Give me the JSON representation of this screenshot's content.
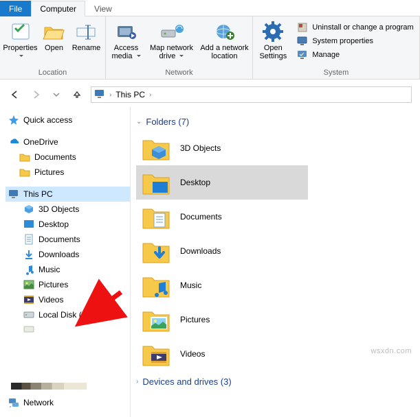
{
  "tabs": {
    "file": "File",
    "computer": "Computer",
    "view": "View"
  },
  "ribbon": {
    "location": {
      "label": "Location",
      "properties": "Properties",
      "open": "Open",
      "rename": "Rename"
    },
    "network": {
      "label": "Network",
      "access_media": "Access media",
      "map_drive": "Map network drive",
      "add_location": "Add a network location"
    },
    "system": {
      "label": "System",
      "open_settings": "Open Settings",
      "uninstall": "Uninstall or change a program",
      "properties": "System properties",
      "manage": "Manage"
    }
  },
  "address": {
    "location": "This PC"
  },
  "tree": {
    "quick_access": "Quick access",
    "onedrive": "OneDrive",
    "onedrive_items": [
      "Documents",
      "Pictures"
    ],
    "this_pc": "This PC",
    "this_pc_items": [
      "3D Objects",
      "Desktop",
      "Documents",
      "Downloads",
      "Music",
      "Pictures",
      "Videos",
      "Local Disk (C:)"
    ],
    "network": "Network"
  },
  "content": {
    "folders_header": "Folders (7)",
    "folders": [
      "3D Objects",
      "Desktop",
      "Documents",
      "Downloads",
      "Music",
      "Pictures",
      "Videos"
    ],
    "selected_folder": "Desktop",
    "devices_header": "Devices and drives (3)"
  },
  "watermark": "wsxdn.com"
}
